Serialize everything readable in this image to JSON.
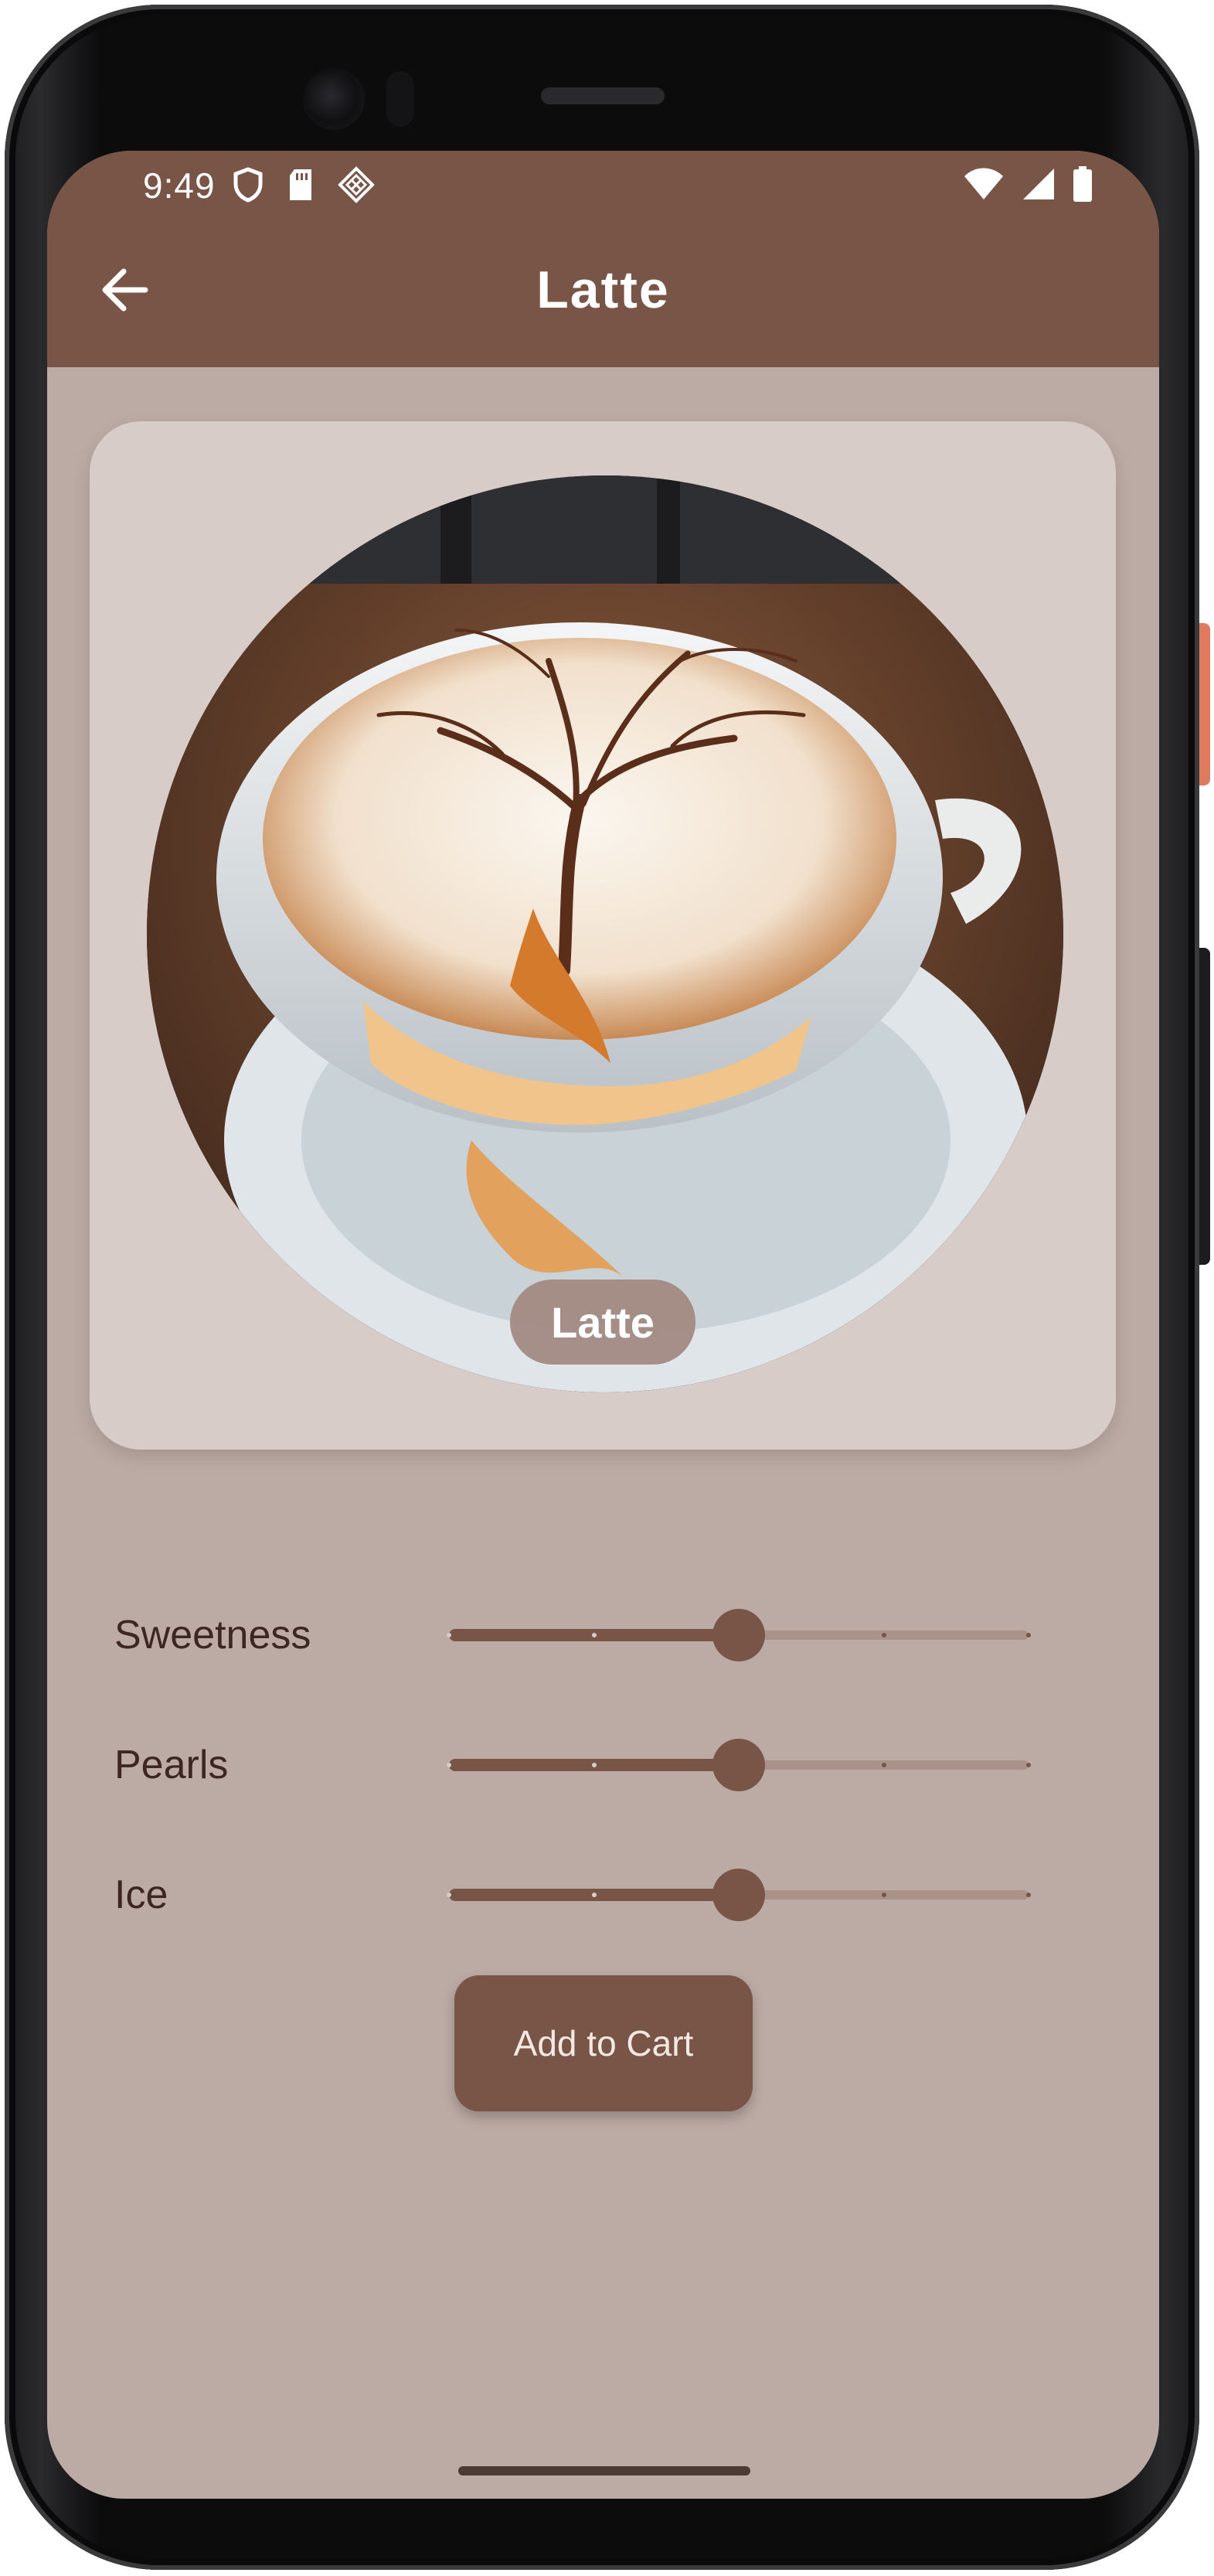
{
  "status_bar": {
    "time": "9:49",
    "left_icons": [
      "shield-icon",
      "sd-card-icon",
      "diamond-grid-icon"
    ],
    "right_icons": [
      "wifi-icon",
      "signal-icon",
      "battery-icon"
    ]
  },
  "app_bar": {
    "back_icon": "arrow-left-icon",
    "title": "Latte"
  },
  "product": {
    "name": "Latte",
    "image": "latte-art-coffee-cup"
  },
  "options": [
    {
      "label": "Sweetness",
      "value_fraction": 0.5,
      "divisions": 4
    },
    {
      "label": "Pearls",
      "value_fraction": 0.5,
      "divisions": 4
    },
    {
      "label": "Ice",
      "value_fraction": 0.5,
      "divisions": 4
    }
  ],
  "actions": {
    "add_to_cart": "Add to Cart"
  },
  "colors": {
    "primary": "#795548",
    "background": "#bcaaa4",
    "card": "#d7ccc8",
    "label_text": "#3e2723"
  }
}
